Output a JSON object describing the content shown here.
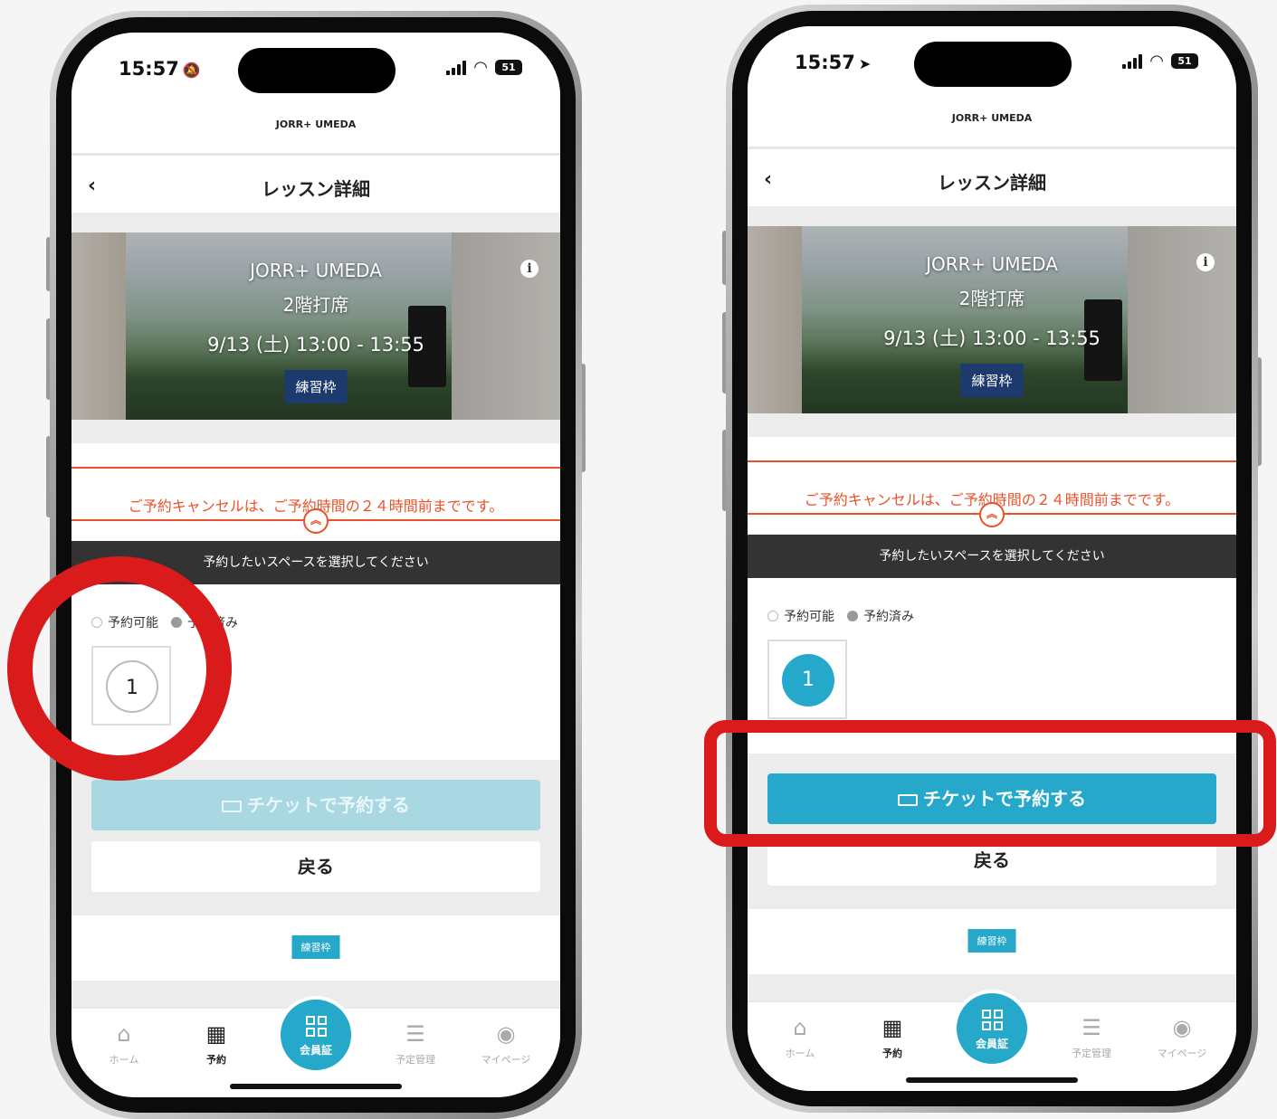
{
  "colors": {
    "accent": "#25a8c9",
    "warning": "#e8522a",
    "highlight": "#d91b1b",
    "badge_navy": "#1d3a6e"
  },
  "phones": [
    {
      "status": {
        "time": "15:57",
        "time_icon": "bell-slash-icon",
        "battery": "51"
      },
      "shop_name": "JORR+ UMEDA",
      "page_title": "レッスン詳細",
      "hero": {
        "name": "JORR+ UMEDA",
        "floor": "2階打席",
        "datetime": "9/13 (土) 13:00 - 13:55",
        "badge": "練習枠"
      },
      "notice": "ご予約キャンセルは、ご予約時間の２４時間前までです。",
      "select_prompt": "予約したいスペースを選択してください",
      "legend": {
        "available": "予約可能",
        "booked": "予約済み"
      },
      "space_number": "1",
      "space_state": "idle",
      "ticket_button": "チケットで予約する",
      "ticket_enabled": false,
      "back_button": "戻る",
      "lower_badge": "練習枠",
      "tabs": {
        "home": "ホーム",
        "reserve": "予約",
        "member_card": "会員証",
        "schedule": "予定管理",
        "mypage": "マイページ"
      }
    },
    {
      "status": {
        "time": "15:57",
        "time_icon": "location-arrow-icon",
        "battery": "51"
      },
      "shop_name": "JORR+ UMEDA",
      "page_title": "レッスン詳細",
      "hero": {
        "name": "JORR+ UMEDA",
        "floor": "2階打席",
        "datetime": "9/13 (土) 13:00 - 13:55",
        "badge": "練習枠"
      },
      "notice": "ご予約キャンセルは、ご予約時間の２４時間前までです。",
      "select_prompt": "予約したいスペースを選択してください",
      "legend": {
        "available": "予約可能",
        "booked": "予約済み"
      },
      "space_number": "1",
      "space_state": "selected",
      "ticket_button": "チケットで予約する",
      "ticket_enabled": true,
      "back_button": "戻る",
      "lower_badge": "練習枠",
      "tabs": {
        "home": "ホーム",
        "reserve": "予約",
        "member_card": "会員証",
        "schedule": "予定管理",
        "mypage": "マイページ"
      }
    }
  ]
}
